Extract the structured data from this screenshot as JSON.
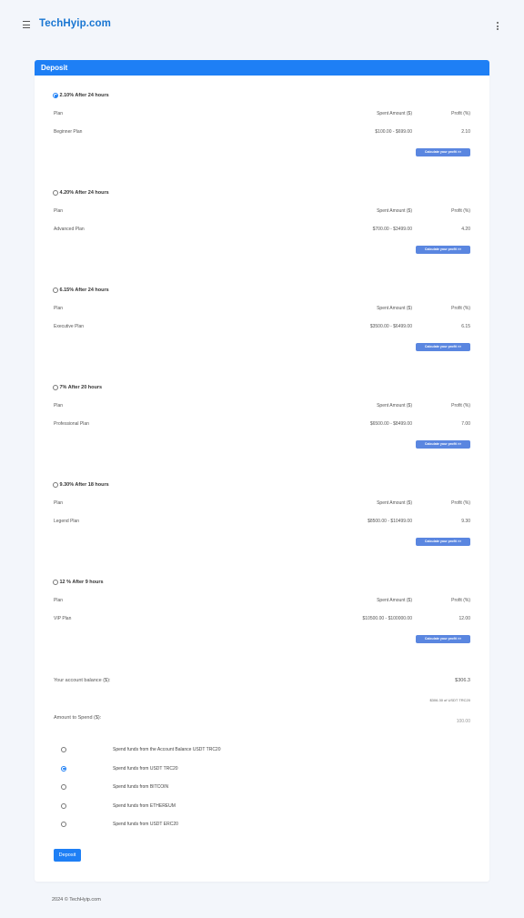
{
  "header": {
    "brand": "TechHyip.com"
  },
  "card": {
    "title": "Deposit"
  },
  "columns": {
    "plan": "Plan",
    "spent": "Spent Amount ($)",
    "profit": "Profit (%)"
  },
  "calc_label": "Calculate your profit >>",
  "plans": [
    {
      "title": "2.10% After 24 hours",
      "name": "Beginner Plan",
      "range": "$100.00 - $699.00",
      "profit": "2.10",
      "selected": true
    },
    {
      "title": "4.20% After 24 hours",
      "name": "Advanced Plan",
      "range": "$700.00 - $3499.00",
      "profit": "4.20",
      "selected": false
    },
    {
      "title": "6.15% After 24 hours",
      "name": "Executive Plan",
      "range": "$3500.00 - $6499.00",
      "profit": "6.15",
      "selected": false
    },
    {
      "title": "7% After 20 hours",
      "name": "Professional Plan",
      "range": "$6500.00 - $8499.00",
      "profit": "7.00",
      "selected": false
    },
    {
      "title": "9.30% After 18 hours",
      "name": "Legend Plan",
      "range": "$8500.00 - $10499.00",
      "profit": "9.30",
      "selected": false
    },
    {
      "title": "12 % After 9 hours",
      "name": "VIP Plan",
      "range": "$10500.00 - $100000.00",
      "profit": "12.00",
      "selected": false
    }
  ],
  "balance": {
    "label": "Your account balance ($):",
    "value": "$306.3",
    "note": "$306.30 of USDT TRC20"
  },
  "amount": {
    "label": "Amount to Spend ($):",
    "value": "100.00"
  },
  "payment_options": [
    {
      "label": "Spend funds from the Account Balance USDT TRC20",
      "selected": false
    },
    {
      "label": "Spend funds from USDT TRC20",
      "selected": true
    },
    {
      "label": "Spend funds from BITCOIN",
      "selected": false
    },
    {
      "label": "Spend funds from ETHEREUM",
      "selected": false
    },
    {
      "label": "Spend funds from USDT ERC20",
      "selected": false
    }
  ],
  "deposit_label": "Deposit",
  "footer": {
    "text": "2024 © TechHyip.com"
  },
  "colors": {
    "accent": "#1e7ff5",
    "calc_button": "#5a86e0",
    "brand": "#1976d2"
  }
}
